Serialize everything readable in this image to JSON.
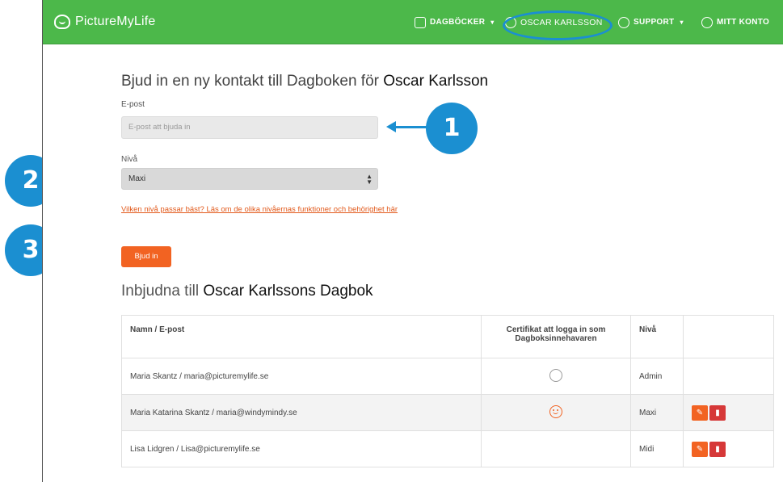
{
  "navbar": {
    "brand": "PictureMyLife",
    "diaries_label": "DAGBÖCKER",
    "owner_label": "OSCAR KARLSSON",
    "support_label": "SUPPORT",
    "account_label": "MITT KONTO",
    "caret": "▾",
    "highlight_color": "#1b8fd1",
    "bar_color": "#4cb84a"
  },
  "form": {
    "heading_prefix": "Bjud in en ny kontakt till Dagboken för ",
    "heading_name": "Oscar Karlsson",
    "email_label": "E-post",
    "email_placeholder": "E-post att bjuda in",
    "level_label": "Nivå",
    "level_value": "Maxi",
    "help_link": "Vilken nivå passar bäst? Läs om de olika nivåernas funktioner och behörighet här",
    "invite_button": "Bjud in",
    "accent_color": "#f26322"
  },
  "invited": {
    "heading_prefix": "Inbjudna till ",
    "heading_name": "Oscar Karlssons Dagbok",
    "columns": [
      "Namn / E-post",
      "Certifikat att logga in som Dagboksinnehavaren",
      "Nivå",
      ""
    ],
    "rows": [
      {
        "name": "Maria Skantz / maria@picturemylife.se",
        "cert": "empty-circle-icon",
        "level": "Admin",
        "actions": false
      },
      {
        "name": "Maria Katarina Skantz / maria@windymindy.se",
        "cert": "smiley-icon",
        "level": "Maxi",
        "actions": true
      },
      {
        "name": "Lisa Lidgren / Lisa@picturemylife.se",
        "cert": "",
        "level": "Midi",
        "actions": true
      }
    ]
  },
  "callouts": [
    "1",
    "2",
    "3"
  ]
}
